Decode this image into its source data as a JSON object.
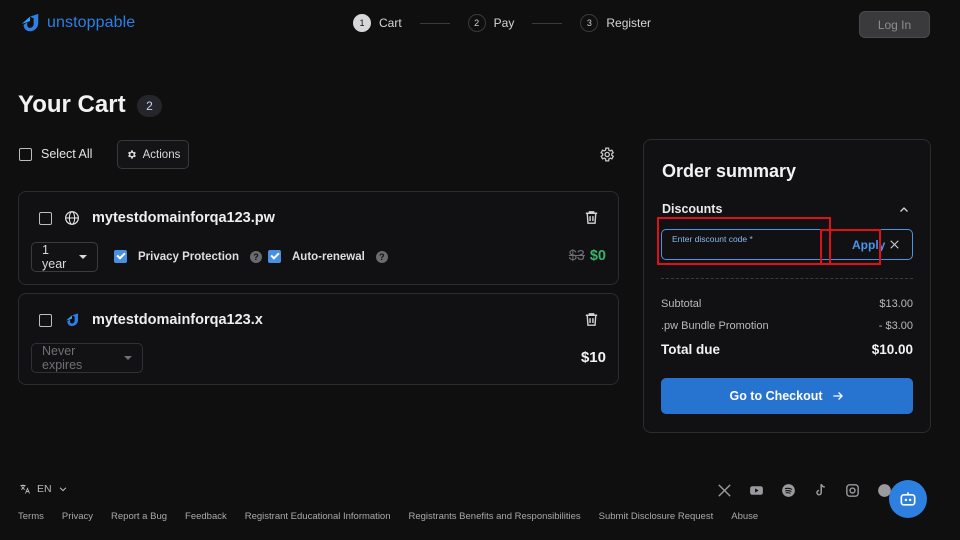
{
  "brand": {
    "name": "unstoppable",
    "accent": "#2f7ee3"
  },
  "steps": [
    {
      "num": "1",
      "label": "Cart"
    },
    {
      "num": "2",
      "label": "Pay"
    },
    {
      "num": "3",
      "label": "Register"
    }
  ],
  "header": {
    "login_label": "Log In"
  },
  "cart": {
    "title": "Your Cart",
    "count": "2",
    "select_all_label": "Select All",
    "actions_label": "Actions",
    "items": [
      {
        "domain": "mytestdomainforqa123.pw",
        "icon": "globe-icon",
        "term": "1 year",
        "privacy_label": "Privacy Protection",
        "autorenew_label": "Auto-renewal",
        "price_old": "$3",
        "price_new": "$0"
      },
      {
        "domain": "mytestdomainforqa123.x",
        "icon": "unstoppable-logo-icon",
        "term": "Never expires",
        "price": "$10"
      }
    ]
  },
  "summary": {
    "title": "Order summary",
    "discounts_label": "Discounts",
    "discount_placeholder": "Enter discount code *",
    "apply_label": "Apply",
    "lines": [
      {
        "label": "Subtotal",
        "value": "$13.00"
      },
      {
        "label": ".pw Bundle Promotion",
        "value": "- $3.00"
      }
    ],
    "total_label": "Total due",
    "total_value": "$10.00",
    "checkout_label": "Go to Checkout"
  },
  "footer": {
    "language": "EN",
    "links": [
      "Terms",
      "Privacy",
      "Report a Bug",
      "Feedback",
      "Registrant Educational Information",
      "Registrants Benefits and Responsibilities",
      "Submit Disclosure Request",
      "Abuse"
    ],
    "socials": [
      "x-icon",
      "youtube-icon",
      "spotify-icon",
      "tiktok-icon",
      "instagram-icon",
      "facebook-icon"
    ]
  }
}
